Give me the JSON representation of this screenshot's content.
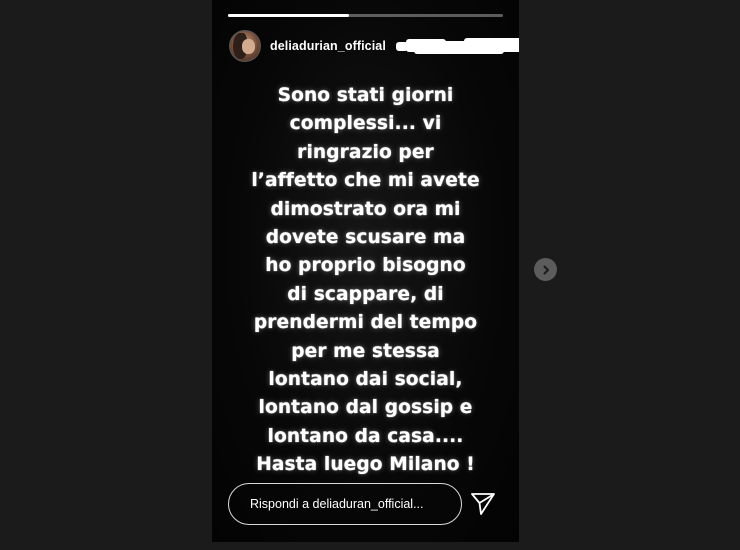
{
  "story": {
    "progress_fraction": 0.44,
    "username": "deliadurian_official",
    "message_lines": [
      "Sono stati giorni",
      "complessi... vi",
      "ringrazio per",
      "l’affetto che mi avete",
      "dimostrato ora mi",
      "dovete scusare ma",
      "ho proprio bisogno",
      "di scappare, di",
      "prendermi del tempo",
      "per me stessa",
      "lontano dai social,",
      "lontano dal gossip e",
      "lontano da casa....",
      "Hasta luego Milano !"
    ]
  },
  "reply": {
    "placeholder": "Rispondi a deliaduran_official..."
  },
  "icons": {
    "send": "paper-plane-icon",
    "next": "chevron-right-icon"
  },
  "colors": {
    "page_background": "#1b1b1b",
    "story_background": "#070707",
    "text": "#ffffff",
    "next_button": "#5c5c5c"
  }
}
